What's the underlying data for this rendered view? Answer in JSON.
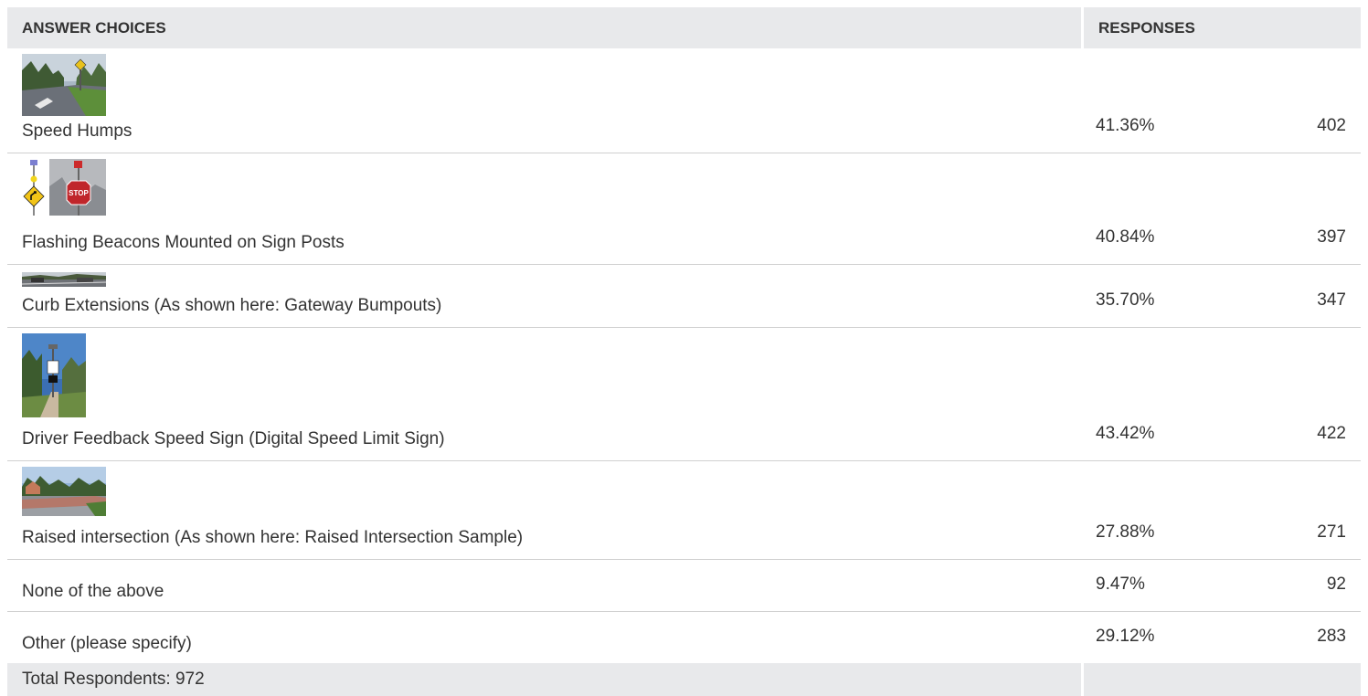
{
  "header": {
    "choices_label": "ANSWER CHOICES",
    "responses_label": "RESPONSES"
  },
  "rows": [
    {
      "label": "Speed Humps",
      "percent": "41.36%",
      "count": "402",
      "image": "speed-humps-photo"
    },
    {
      "label": "Flashing Beacons Mounted on Sign Posts",
      "percent": "40.84%",
      "count": "397",
      "image": "flashing-beacons-photo"
    },
    {
      "label": "Curb Extensions (As shown here: Gateway Bumpouts)",
      "percent": "35.70%",
      "count": "347",
      "image": "curb-extensions-photo"
    },
    {
      "label": "Driver Feedback Speed Sign (Digital Speed Limit Sign)",
      "percent": "43.42%",
      "count": "422",
      "image": "driver-feedback-sign-photo"
    },
    {
      "label": "Raised intersection (As shown here: Raised Intersection Sample)",
      "percent": "27.88%",
      "count": "271",
      "image": "raised-intersection-photo"
    },
    {
      "label": "None of the above",
      "percent": "9.47%",
      "count": "92"
    },
    {
      "label": "Other (please specify)",
      "percent": "29.12%",
      "count": "283"
    }
  ],
  "footer": {
    "total_label": "Total Respondents: 972"
  }
}
